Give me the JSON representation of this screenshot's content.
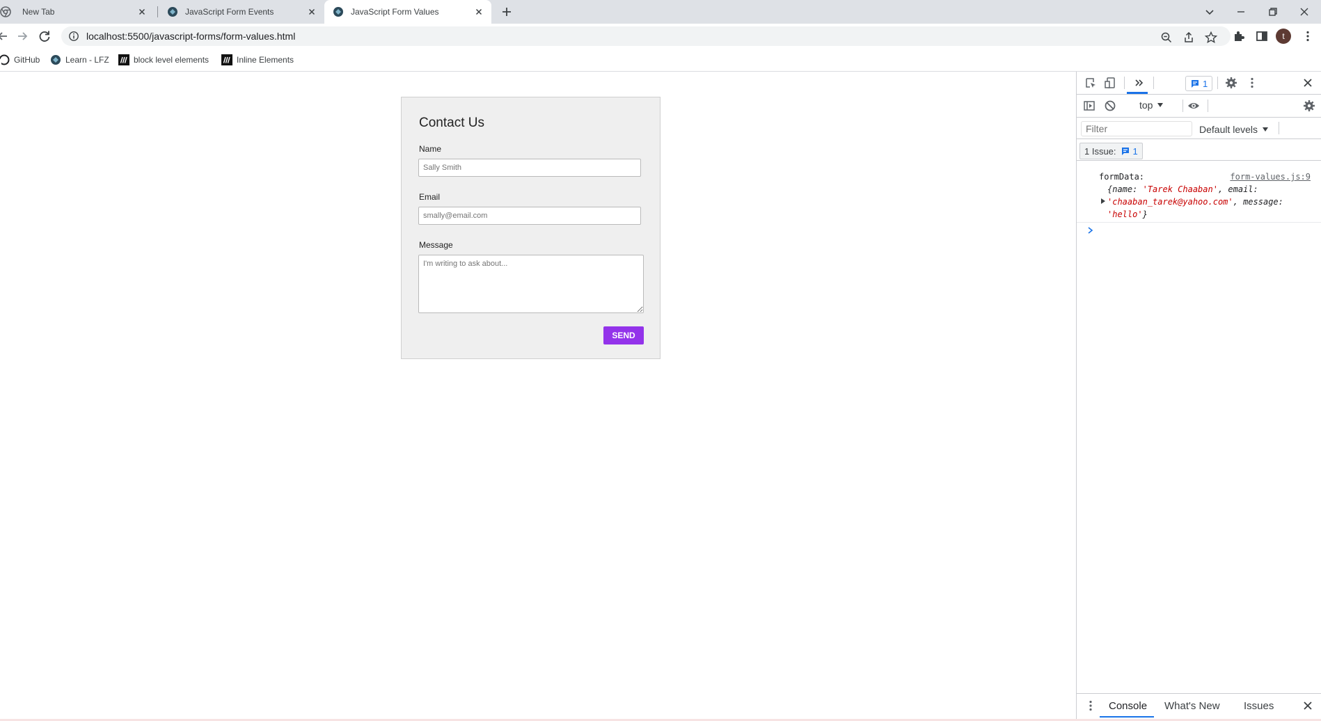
{
  "browser": {
    "tabs": [
      {
        "title": "New Tab",
        "icon": "chrome-icon"
      },
      {
        "title": "JavaScript Form Events",
        "icon": "globe-icon"
      },
      {
        "title": "JavaScript Form Values",
        "icon": "globe-icon",
        "active": true
      }
    ],
    "url": "localhost:5500/javascript-forms/form-values.html",
    "avatar_letter": "t",
    "bookmarks": [
      {
        "label": "GitHub",
        "icon": "github-icon"
      },
      {
        "label": "Learn - LFZ",
        "icon": "lfz-icon"
      },
      {
        "label": "block level elements",
        "icon": "mdn-icon"
      },
      {
        "label": "Inline Elements",
        "icon": "mdn-icon"
      }
    ]
  },
  "form": {
    "title": "Contact Us",
    "name_label": "Name",
    "name_placeholder": "Sally Smith",
    "email_label": "Email",
    "email_placeholder": "smally@email.com",
    "message_label": "Message",
    "message_placeholder": "I'm writing to ask about...",
    "send_label": "SEND",
    "accent_color": "#9333ea"
  },
  "devtools": {
    "issues_count": "1",
    "context": "top",
    "filter_placeholder": "Filter",
    "levels": "Default levels",
    "issue_chip_label": "1 Issue:",
    "issue_chip_count": "1",
    "log": {
      "label": "formData:",
      "source": "form-values.js:9",
      "obj_open": "{name: ",
      "name_value": "'Tarek Chaaban'",
      "email_key": ", email: ",
      "email_value": "'chaaban_tarek@yahoo.com'",
      "message_key": ", message: ",
      "message_value": "'hello'",
      "obj_close": "}"
    },
    "drawer_tabs": [
      "Console",
      "What's New",
      "Issues"
    ]
  }
}
